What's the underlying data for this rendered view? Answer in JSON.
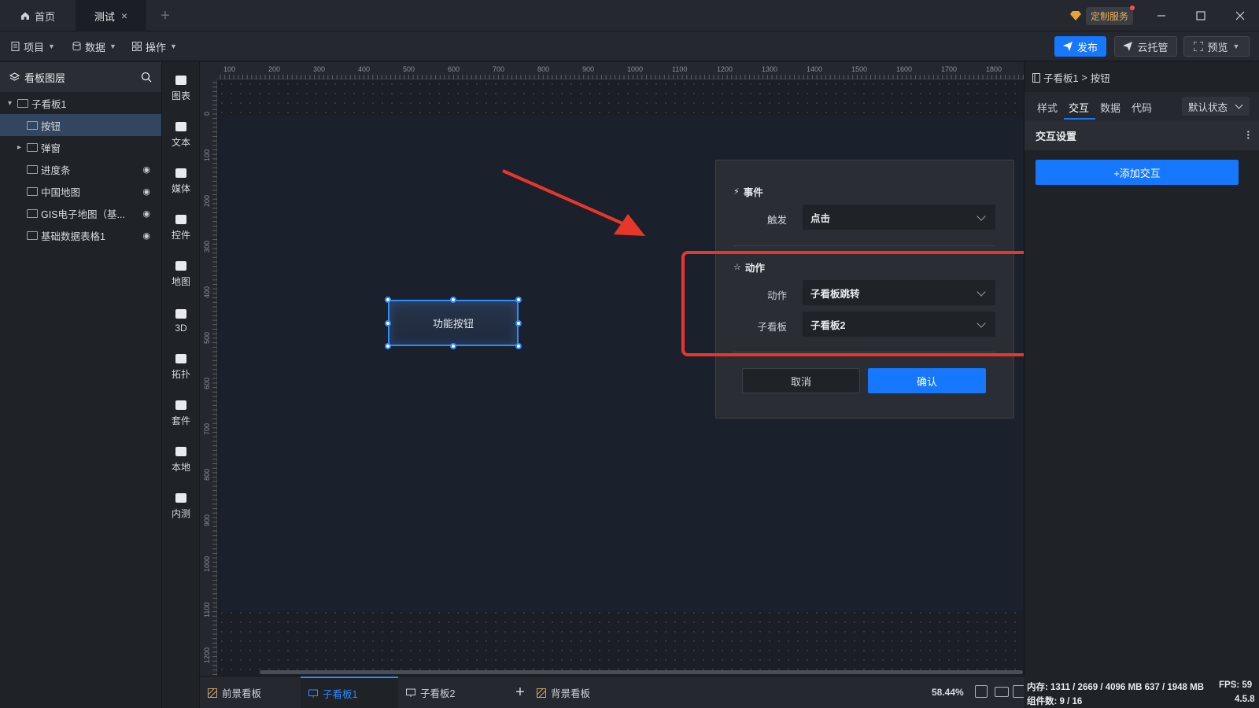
{
  "titlebar": {
    "home_tab": "首页",
    "test_tab": "测试",
    "close_glyph": "×",
    "add_glyph": "+",
    "custom_service": "定制服务"
  },
  "toolbar": {
    "project": "项目",
    "data": "数据",
    "operate": "操作",
    "publish": "发布",
    "cloud": "云托管",
    "preview": "预览"
  },
  "layers": {
    "title": "看板图层",
    "items": [
      {
        "label": "子看板1",
        "level": 0,
        "hidden": false,
        "selected": false,
        "expanded": true
      },
      {
        "label": "按钮",
        "level": 1,
        "hidden": false,
        "selected": true
      },
      {
        "label": "弹窗",
        "level": 1,
        "hidden": false,
        "selected": false,
        "collapsed": true
      },
      {
        "label": "进度条",
        "level": 1,
        "hidden": true,
        "selected": false
      },
      {
        "label": "中国地图",
        "level": 1,
        "hidden": true,
        "selected": false
      },
      {
        "label": "GIS电子地图（基...",
        "level": 1,
        "hidden": true,
        "selected": false
      },
      {
        "label": "基础数据表格1",
        "level": 1,
        "hidden": true,
        "selected": false
      }
    ]
  },
  "rail": {
    "items": [
      "图表",
      "文本",
      "媒体",
      "控件",
      "地图",
      "3D",
      "拓扑",
      "套件",
      "本地",
      "内测"
    ]
  },
  "ruler": {
    "h_ticks": [
      "100",
      "200",
      "300",
      "400",
      "500",
      "600",
      "700",
      "800",
      "900",
      "1000",
      "1100",
      "1200",
      "1300",
      "1400",
      "1500",
      "1600",
      "1700",
      "1800"
    ],
    "v_ticks": [
      "0",
      "100",
      "200",
      "300",
      "400",
      "500",
      "600",
      "700",
      "800",
      "900",
      "1000",
      "1100",
      "1200"
    ]
  },
  "canvas": {
    "button_label": "功能按钮"
  },
  "dialog": {
    "event_title": "事件",
    "trigger_label": "触发",
    "trigger_value": "点击",
    "action_title": "动作",
    "action_label": "动作",
    "action_value": "子看板跳转",
    "subboard_label": "子看板",
    "subboard_value": "子看板2",
    "cancel": "取消",
    "confirm": "确认"
  },
  "right_panel": {
    "breadcrumb_parent": "子看板1",
    "breadcrumb_sep": ">",
    "breadcrumb_current": "按钮",
    "tabs": [
      "样式",
      "交互",
      "数据",
      "代码"
    ],
    "active_tab": "交互",
    "state": "默认状态",
    "section_title": "交互设置",
    "add_interaction": "+添加交互"
  },
  "bottom_tabs": [
    "前景看板",
    "子看板1",
    "子看板2",
    "背景看板"
  ],
  "bottom_active": "子看板1",
  "zoom": "58.44%",
  "status": {
    "memory": "内存: 1311 / 2669 / 4096 MB  637 / 1948 MB",
    "fps": "FPS: 59",
    "components": "组件数: 9 / 16",
    "version": "4.5.8"
  },
  "colors": {
    "accent": "#1677ff",
    "highlight": "#e8372a",
    "selection": "#2f8cff"
  }
}
